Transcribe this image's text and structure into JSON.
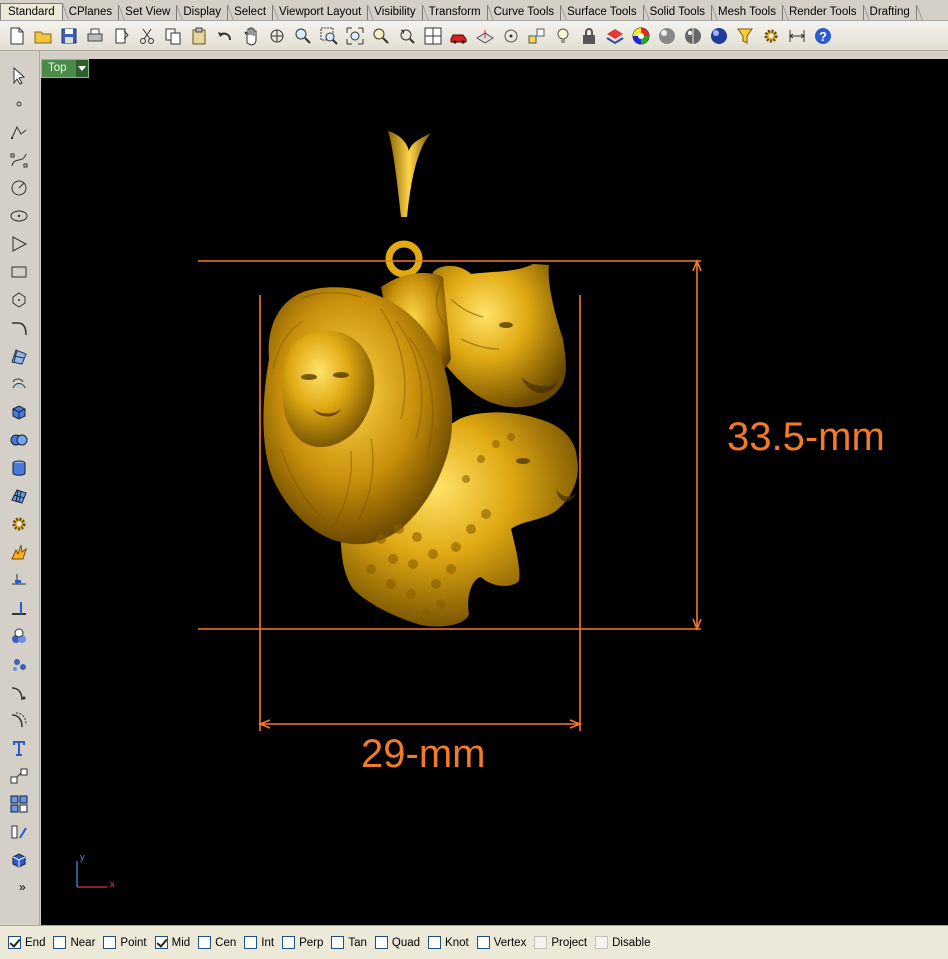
{
  "tabs": [
    "Standard",
    "CPlanes",
    "Set View",
    "Display",
    "Select",
    "Viewport Layout",
    "Visibility",
    "Transform",
    "Curve Tools",
    "Surface Tools",
    "Solid Tools",
    "Mesh Tools",
    "Render Tools",
    "Drafting"
  ],
  "active_tab": "Standard",
  "top_tools": [
    "new-icon",
    "open-icon",
    "save-icon",
    "print-icon",
    "import-icon",
    "cut-icon",
    "copy-icon",
    "paste-icon",
    "undo-icon",
    "pan-hand-icon",
    "rotate-view-icon",
    "zoom-icon",
    "zoom-window-icon",
    "zoom-extents-icon",
    "zoom-selected-icon",
    "undo-view-icon",
    "four-viewports-icon",
    "car-icon",
    "cplane-icon",
    "point-cloud-icon",
    "osnap-icon",
    "light-bulb-icon",
    "lock-icon",
    "layer-color-icon",
    "color-wheel-icon",
    "render-sphere-icon",
    "shaded-sphere-icon",
    "blue-sphere-icon",
    "select-filter-icon",
    "options-gear-icon",
    "dimension-icon",
    "help-icon"
  ],
  "left_tools": [
    "select-arrow-icon",
    "point-icon",
    "polyline-icon",
    "curve-icon",
    "circle-icon",
    "ellipse-icon",
    "polygon-icon",
    "rectangle-icon",
    "hexagon-icon",
    "arc-icon",
    "surface-pts-icon",
    "extrude-curve-icon",
    "box-solid-icon",
    "boolean-union-icon",
    "cylinder-icon",
    "mesh-surface-icon",
    "gear-plugin-icon",
    "explode-icon",
    "trim-icon",
    "split-icon",
    "group-icon",
    "boolean-diff-icon",
    "fillet-curve-icon",
    "offset-curve-icon",
    "text-icon",
    "move-icon",
    "array-icon",
    "mirror-icon",
    "shaded-box-icon"
  ],
  "more_tools_label": "»",
  "viewport": {
    "name": "Top",
    "height_dimension": "33.5-mm",
    "width_dimension": "29-mm",
    "axis_x": "x",
    "axis_y": "y"
  },
  "colors": {
    "dimension": "#f27b28",
    "gold": "#d9a30f",
    "viewport_bg": "#000000",
    "viewport_label": "#4a8a4a"
  },
  "osnaps": [
    {
      "label": "End",
      "checked": true,
      "enabled": true
    },
    {
      "label": "Near",
      "checked": false,
      "enabled": true
    },
    {
      "label": "Point",
      "checked": false,
      "enabled": true
    },
    {
      "label": "Mid",
      "checked": true,
      "enabled": true
    },
    {
      "label": "Cen",
      "checked": false,
      "enabled": true
    },
    {
      "label": "Int",
      "checked": false,
      "enabled": true
    },
    {
      "label": "Perp",
      "checked": false,
      "enabled": true
    },
    {
      "label": "Tan",
      "checked": false,
      "enabled": true
    },
    {
      "label": "Quad",
      "checked": false,
      "enabled": true
    },
    {
      "label": "Knot",
      "checked": false,
      "enabled": true
    },
    {
      "label": "Vertex",
      "checked": false,
      "enabled": true
    },
    {
      "label": "Project",
      "checked": false,
      "enabled": false
    },
    {
      "label": "Disable",
      "checked": false,
      "enabled": false
    }
  ]
}
